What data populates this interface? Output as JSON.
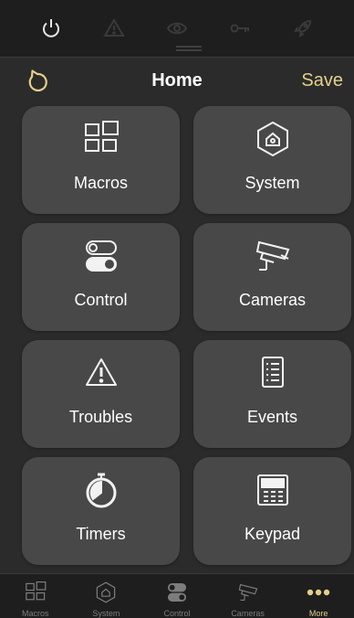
{
  "header": {
    "title": "Home",
    "save_label": "Save"
  },
  "status_icons": [
    "power-icon",
    "warning-icon",
    "eye-icon",
    "key-icon",
    "rocket-icon"
  ],
  "tiles": [
    {
      "label": "Macros",
      "icon": "macros-grid-icon"
    },
    {
      "label": "System",
      "icon": "hexagon-lock-icon"
    },
    {
      "label": "Control",
      "icon": "toggle-switches-icon"
    },
    {
      "label": "Cameras",
      "icon": "security-camera-icon"
    },
    {
      "label": "Troubles",
      "icon": "warning-triangle-icon"
    },
    {
      "label": "Events",
      "icon": "list-document-icon"
    },
    {
      "label": "Timers",
      "icon": "stopwatch-icon"
    },
    {
      "label": "Keypad",
      "icon": "keypad-icon"
    }
  ],
  "tabs": [
    {
      "label": "Macros",
      "icon": "macros-grid-icon"
    },
    {
      "label": "System",
      "icon": "hexagon-lock-icon"
    },
    {
      "label": "Control",
      "icon": "toggle-switches-icon"
    },
    {
      "label": "Cameras",
      "icon": "security-camera-icon"
    },
    {
      "label": "More",
      "icon": "more-dots-icon",
      "active": true
    }
  ],
  "colors": {
    "accent": "#e6cf8a",
    "background": "#2b2b2b",
    "tile": "#484848",
    "bar": "#1e1e1e"
  }
}
